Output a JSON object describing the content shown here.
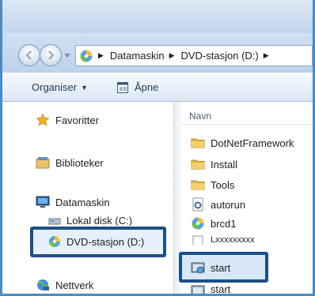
{
  "address": {
    "crumbs": [
      "Datamaskin",
      "DVD-stasjon (D:)"
    ]
  },
  "toolbar": {
    "organise_label": "Organiser",
    "open_label": "Åpne"
  },
  "nav_pane": {
    "favorites": "Favoritter",
    "libraries": "Biblioteker",
    "computer": "Datamaskin",
    "local_disk": "Lokal disk (C:)",
    "dvd_drive": "DVD-stasjon (D:)",
    "network": "Nettverk"
  },
  "file_list": {
    "column_name": "Navn",
    "items": [
      {
        "name": "DotNetFramework",
        "icon": "folder-icon"
      },
      {
        "name": "Install",
        "icon": "folder-icon"
      },
      {
        "name": "Tools",
        "icon": "folder-icon"
      },
      {
        "name": "autorun",
        "icon": "settings-file-icon"
      },
      {
        "name": "brcd1",
        "icon": "disc-app-icon"
      },
      {
        "name": "Lxxxxxxxxx",
        "icon": "document-icon"
      },
      {
        "name": "start",
        "icon": "installer-icon"
      },
      {
        "name": "start",
        "icon": "installer-icon"
      }
    ]
  },
  "colors": {
    "highlight_border": "#1b4f86",
    "frame": "#4a8bc2"
  }
}
